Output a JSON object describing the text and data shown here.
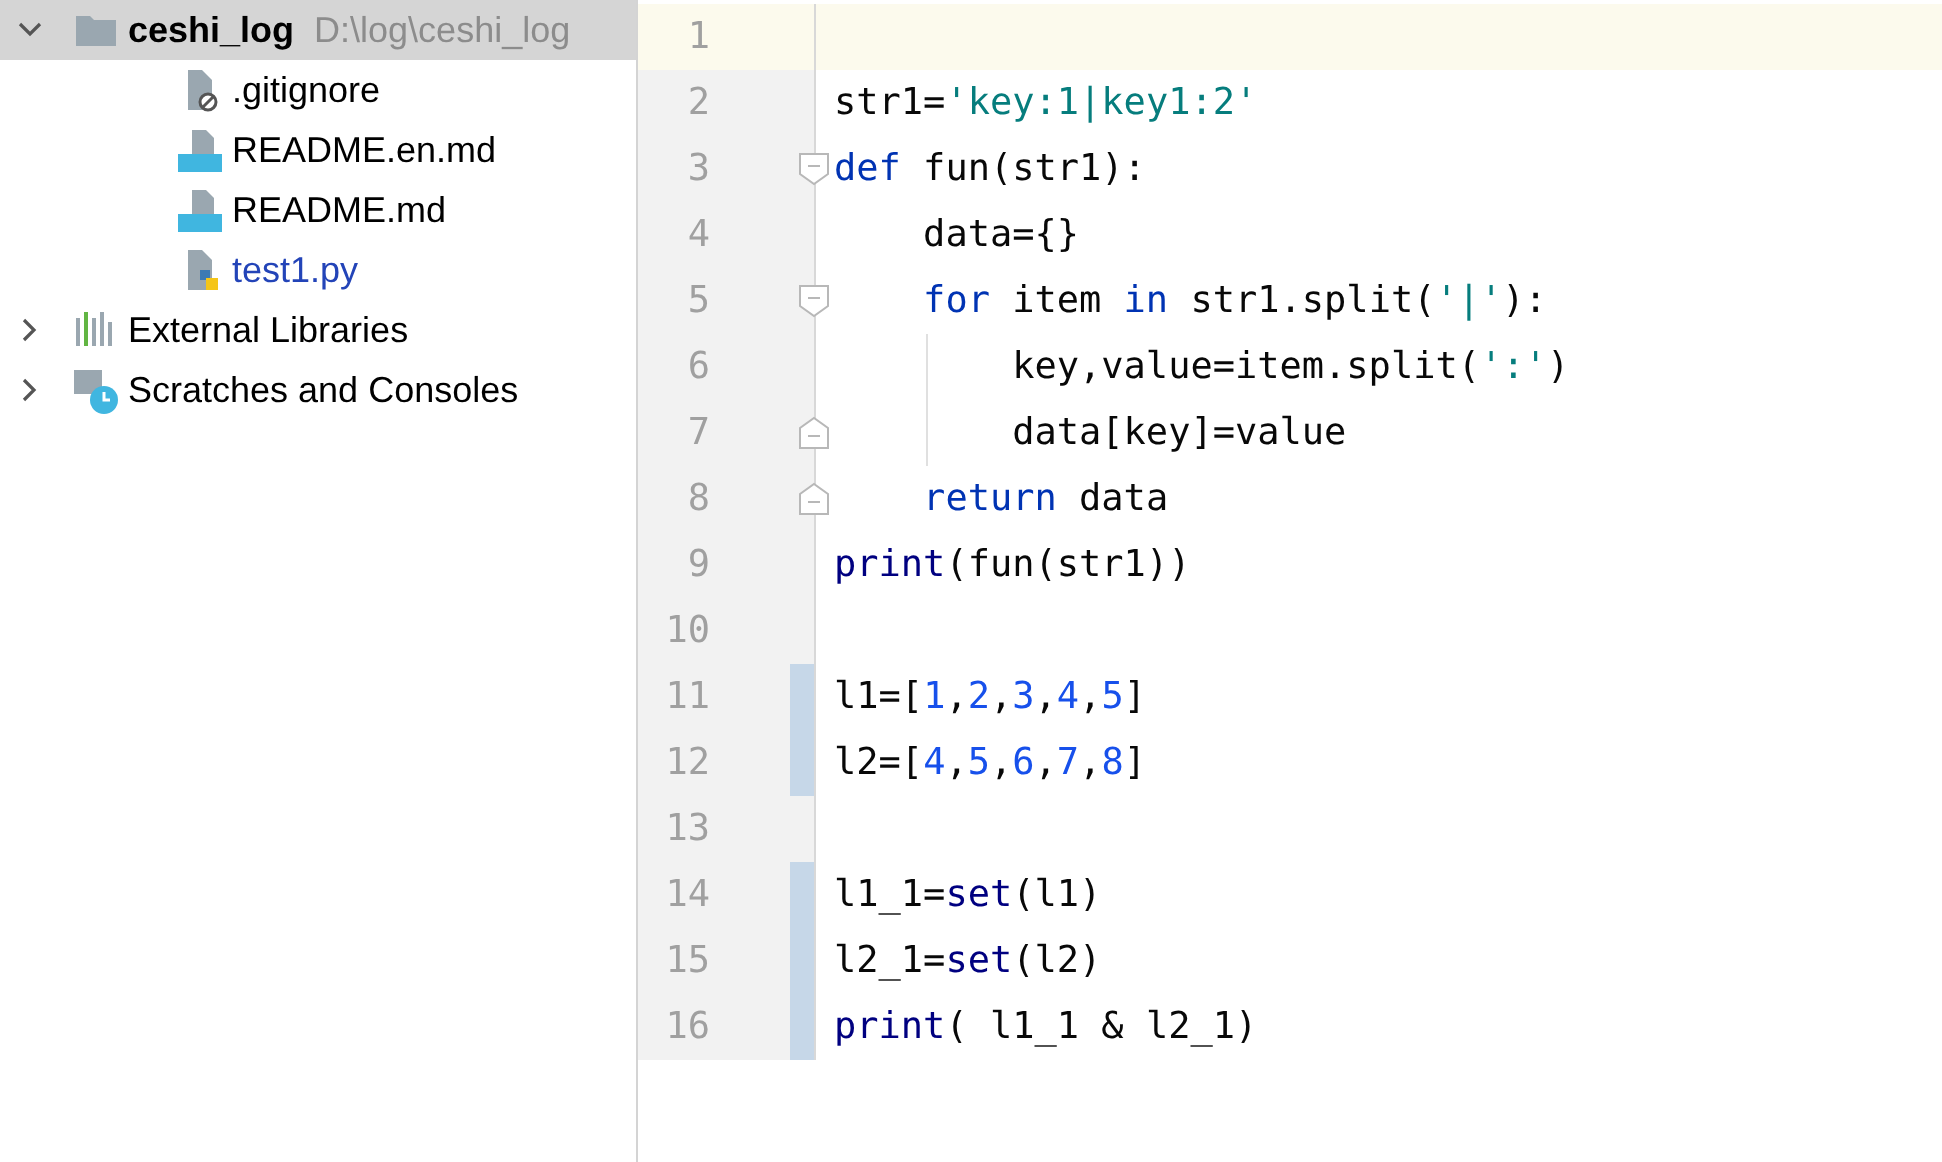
{
  "project_tree": [
    {
      "kind": "folder",
      "name": "ceshi_log",
      "path": "D:\\log\\ceshi_log",
      "expanded": true,
      "selected": true,
      "children": [
        {
          "kind": "gitignore",
          "name": ".gitignore",
          "color": "#000000"
        },
        {
          "kind": "markdown",
          "name": "README.en.md",
          "color": "#000000"
        },
        {
          "kind": "markdown",
          "name": "README.md",
          "color": "#000000"
        },
        {
          "kind": "python",
          "name": "test1.py",
          "color": "#2344b8"
        }
      ]
    },
    {
      "kind": "libraries",
      "name": "External Libraries",
      "expanded": false,
      "selected": false
    },
    {
      "kind": "scratches",
      "name": "Scratches and Consoles",
      "expanded": false,
      "selected": false
    }
  ],
  "editor": {
    "lines": [
      {
        "number": "1",
        "current": true,
        "changed": false,
        "fold_start": false,
        "fold_end": false
      },
      {
        "number": "2",
        "current": false,
        "changed": false,
        "fold_start": false,
        "fold_end": false,
        "tokens": [
          {
            "kind": "plain",
            "text": "str1="
          },
          {
            "kind": "string",
            "text": "'key:1|key1:2'"
          }
        ]
      },
      {
        "number": "3",
        "current": false,
        "changed": false,
        "fold_start": true,
        "fold_end": false,
        "tokens": [
          {
            "kind": "keyword",
            "text": "def"
          },
          {
            "kind": "plain",
            "text": " fun(str1):"
          }
        ]
      },
      {
        "number": "4",
        "current": false,
        "changed": false,
        "fold_start": false,
        "fold_end": false,
        "tokens": [
          {
            "kind": "plain",
            "text": "    data={}"
          }
        ]
      },
      {
        "number": "5",
        "current": false,
        "changed": false,
        "fold_start": true,
        "fold_end": false,
        "tokens": [
          {
            "kind": "keyword",
            "text": "    for"
          },
          {
            "kind": "plain",
            "text": " item "
          },
          {
            "kind": "keyword",
            "text": "in"
          },
          {
            "kind": "plain",
            "text": " str1.split("
          },
          {
            "kind": "string",
            "text": "'|'"
          },
          {
            "kind": "plain",
            "text": "):"
          }
        ]
      },
      {
        "number": "6",
        "current": false,
        "changed": false,
        "fold_start": false,
        "fold_end": false,
        "tokens": [
          {
            "kind": "plain",
            "text": "        key,value=item.split("
          },
          {
            "kind": "string",
            "text": "':'"
          },
          {
            "kind": "plain",
            "text": ")"
          }
        ]
      },
      {
        "number": "7",
        "current": false,
        "changed": false,
        "fold_start": false,
        "fold_end": true,
        "tokens": [
          {
            "kind": "plain",
            "text": "        data[key]=value"
          }
        ]
      },
      {
        "number": "8",
        "current": false,
        "changed": false,
        "fold_start": false,
        "fold_end": true,
        "tokens": [
          {
            "kind": "keyword",
            "text": "    return"
          },
          {
            "kind": "plain",
            "text": " data"
          }
        ]
      },
      {
        "number": "9",
        "current": false,
        "changed": false,
        "fold_start": false,
        "fold_end": false,
        "tokens": [
          {
            "kind": "builtin",
            "text": "print"
          },
          {
            "kind": "plain",
            "text": "(fun(str1))"
          }
        ]
      },
      {
        "number": "10",
        "current": false,
        "changed": false,
        "fold_start": false,
        "fold_end": false
      },
      {
        "number": "11",
        "current": false,
        "changed": true,
        "fold_start": false,
        "fold_end": false,
        "tokens": [
          {
            "kind": "plain",
            "text": "l1=["
          },
          {
            "kind": "number",
            "text": "1"
          },
          {
            "kind": "plain",
            "text": ","
          },
          {
            "kind": "number",
            "text": "2"
          },
          {
            "kind": "plain",
            "text": ","
          },
          {
            "kind": "number",
            "text": "3"
          },
          {
            "kind": "plain",
            "text": ","
          },
          {
            "kind": "number",
            "text": "4"
          },
          {
            "kind": "plain",
            "text": ","
          },
          {
            "kind": "number",
            "text": "5"
          },
          {
            "kind": "plain",
            "text": "]"
          }
        ]
      },
      {
        "number": "12",
        "current": false,
        "changed": true,
        "fold_start": false,
        "fold_end": false,
        "tokens": [
          {
            "kind": "plain",
            "text": "l2=["
          },
          {
            "kind": "number",
            "text": "4"
          },
          {
            "kind": "plain",
            "text": ","
          },
          {
            "kind": "number",
            "text": "5"
          },
          {
            "kind": "plain",
            "text": ","
          },
          {
            "kind": "number",
            "text": "6"
          },
          {
            "kind": "plain",
            "text": ","
          },
          {
            "kind": "number",
            "text": "7"
          },
          {
            "kind": "plain",
            "text": ","
          },
          {
            "kind": "number",
            "text": "8"
          },
          {
            "kind": "plain",
            "text": "]"
          }
        ]
      },
      {
        "number": "13",
        "current": false,
        "changed": false,
        "fold_start": false,
        "fold_end": false
      },
      {
        "number": "14",
        "current": false,
        "changed": true,
        "fold_start": false,
        "fold_end": false,
        "tokens": [
          {
            "kind": "plain",
            "text": "l1_1="
          },
          {
            "kind": "builtin",
            "text": "set"
          },
          {
            "kind": "plain",
            "text": "(l1)"
          }
        ]
      },
      {
        "number": "15",
        "current": false,
        "changed": true,
        "fold_start": false,
        "fold_end": false,
        "tokens": [
          {
            "kind": "plain",
            "text": "l2_1="
          },
          {
            "kind": "builtin",
            "text": "set"
          },
          {
            "kind": "plain",
            "text": "(l2)"
          }
        ]
      },
      {
        "number": "16",
        "current": false,
        "changed": true,
        "fold_start": false,
        "fold_end": false,
        "tokens": [
          {
            "kind": "builtin",
            "text": "print"
          },
          {
            "kind": "plain",
            "text": "( l1_1 & l2_1)"
          }
        ]
      }
    ]
  }
}
